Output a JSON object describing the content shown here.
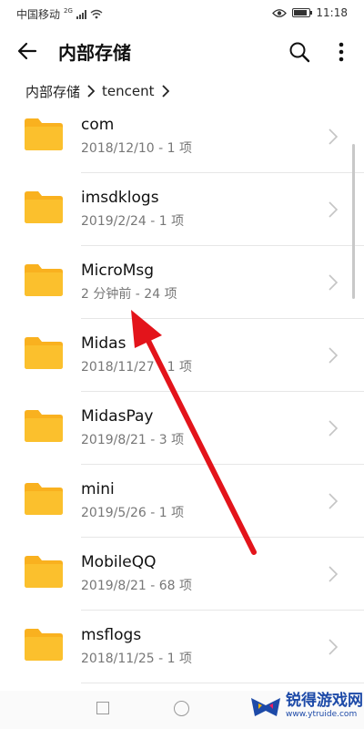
{
  "status_bar": {
    "carrier": "中国移动",
    "network": "2G",
    "time": "11:18"
  },
  "app_bar": {
    "title": "内部存储",
    "back_icon": "arrow-left-icon",
    "search_icon": "search-icon",
    "more_icon": "more-vertical-icon"
  },
  "breadcrumb": {
    "items": [
      "内部存储",
      "tencent"
    ]
  },
  "folders": [
    {
      "name": "com",
      "meta": "2018/12/10 - 1 项"
    },
    {
      "name": "imsdklogs",
      "meta": "2019/2/24 - 1 项"
    },
    {
      "name": "MicroMsg",
      "meta": "2 分钟前 - 24 项"
    },
    {
      "name": "Midas",
      "meta": "2018/11/27 - 1 项"
    },
    {
      "name": "MidasPay",
      "meta": "2019/8/21 - 3 项"
    },
    {
      "name": "mini",
      "meta": "2019/5/26 - 1 项"
    },
    {
      "name": "MobileQQ",
      "meta": "2019/8/21 - 68 项"
    },
    {
      "name": "msflogs",
      "meta": "2018/11/25 - 1 项"
    }
  ],
  "colors": {
    "folder": "#FBC02D",
    "folder_tab": "#F9B11F",
    "annotation_arrow": "#E3141B",
    "watermark": "#1D4AA8"
  },
  "watermark": {
    "name": "锐得游戏网",
    "url": "www.ytruide.com"
  }
}
